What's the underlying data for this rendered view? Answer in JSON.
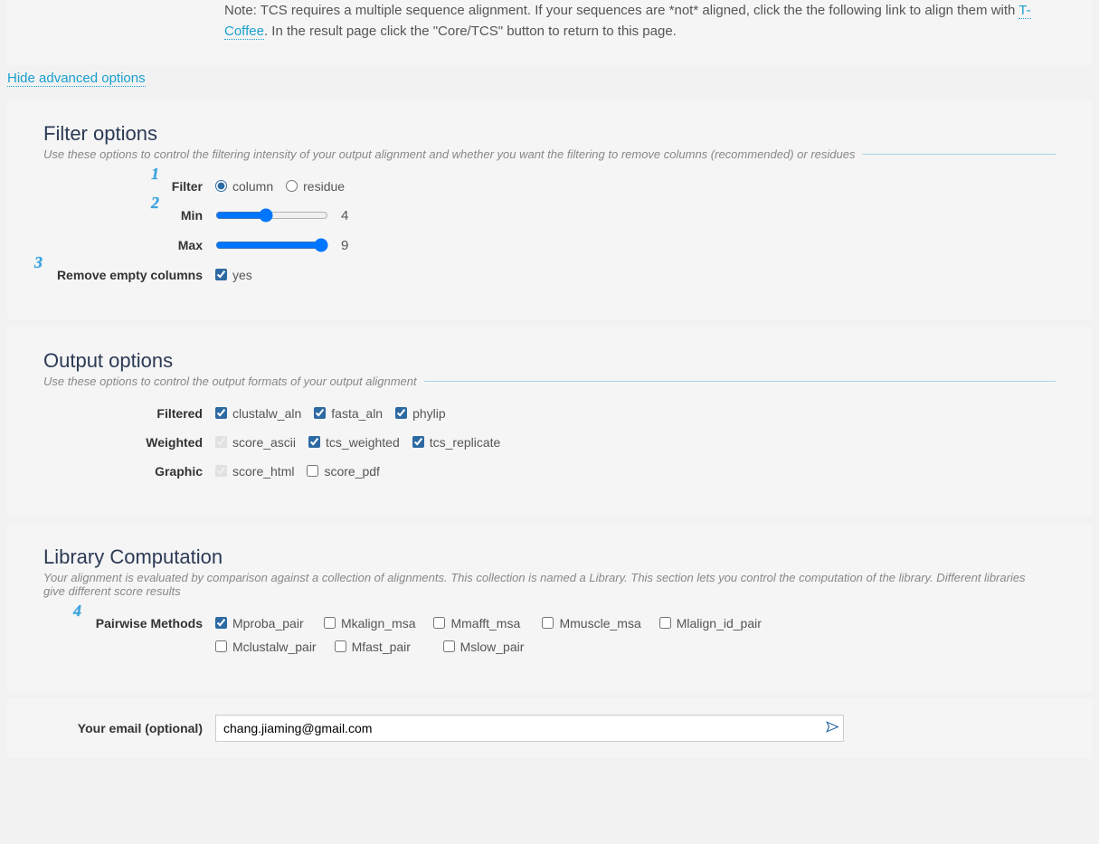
{
  "note": {
    "prefix": "Note: TCS requires a multiple sequence alignment. If your sequences are *not* aligned, click the the following link to align them with ",
    "link_text": "T-Coffee",
    "suffix": ". In the result page click the \"Core/TCS\" button to return to this page."
  },
  "toggle_link": "Hide advanced options",
  "filter": {
    "title": "Filter options",
    "desc": "Use these options to control the filtering intensity of your output alignment and whether you want the filtering to remove columns (recommended) or residues",
    "step1": "1",
    "step2": "2",
    "step3": "3",
    "filter_label": "Filter",
    "option_column": "column",
    "option_residue": "residue",
    "min_label": "Min",
    "min_value": "4",
    "max_label": "Max",
    "max_value": "9",
    "remove_label": "Remove empty columns",
    "yes_label": "yes"
  },
  "output": {
    "title": "Output options",
    "desc": "Use these options to control the output formats of your output alignment",
    "filtered_label": "Filtered",
    "filtered_opts": [
      "clustalw_aln",
      "fasta_aln",
      "phylip"
    ],
    "weighted_label": "Weighted",
    "weighted_opts": [
      "score_ascii",
      "tcs_weighted",
      "tcs_replicate"
    ],
    "graphic_label": "Graphic",
    "graphic_opts": [
      "score_html",
      "score_pdf"
    ]
  },
  "library": {
    "title": "Library Computation",
    "desc": "Your alignment is evaluated by comparison against a collection of alignments. This collection is named a Library. This section lets you control the computation of the library. Different libraries give different score results",
    "step4": "4",
    "pm_label": "Pairwise Methods",
    "row1": [
      "Mproba_pair",
      "Mkalign_msa",
      "Mmafft_msa",
      "Mmuscle_msa",
      "Mlalign_id_pair"
    ],
    "row2": [
      "Mclustalw_pair",
      "Mfast_pair",
      "Mslow_pair"
    ]
  },
  "email": {
    "label": "Your email (optional)",
    "value": "chang.jiaming@gmail.com"
  }
}
